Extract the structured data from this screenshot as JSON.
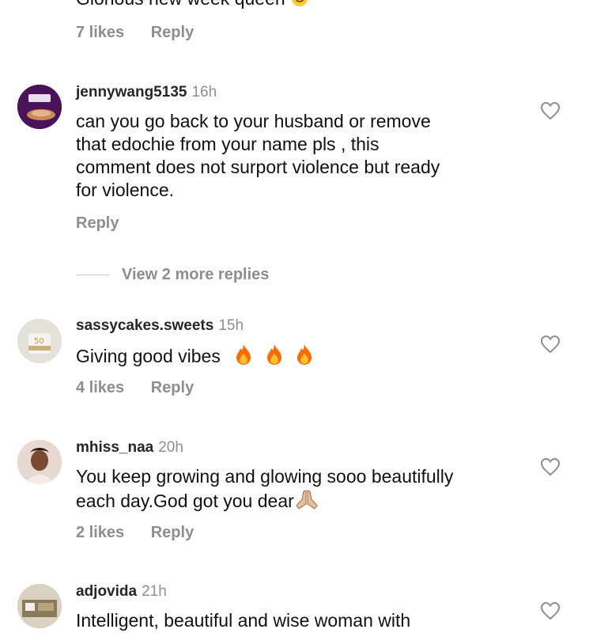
{
  "top_comment": {
    "text": "Glorious new week queen",
    "likes": "7 likes",
    "reply": "Reply"
  },
  "comments": [
    {
      "username": "jennywang5135",
      "time": "16h",
      "lines": [
        "can you go back to your husband or remove",
        "that edochie from your name pls , this",
        "comment does not surport violence but ready",
        "for violence."
      ],
      "reply": "Reply",
      "view_replies": "View 2 more replies"
    },
    {
      "username": "sassycakes.sweets",
      "time": "15h",
      "text": "Giving good vibes",
      "emoji": "fire-icon x3",
      "likes": "4 likes",
      "reply": "Reply"
    },
    {
      "username": "mhiss_naa",
      "time": "20h",
      "lines": [
        "You keep growing and glowing sooo beautifully",
        "each day.God got you dear"
      ],
      "emoji": "praying-hands-icon",
      "likes": "2 likes",
      "reply": "Reply"
    },
    {
      "username": "adjovida",
      "time": "21h",
      "text": "Intelligent, beautiful and wise woman with"
    }
  ],
  "icons": {
    "like": "heart-outline-icon"
  },
  "colors": {
    "muted": "#8e8e8e",
    "text": "#111111",
    "fire": "#ff6a00"
  }
}
